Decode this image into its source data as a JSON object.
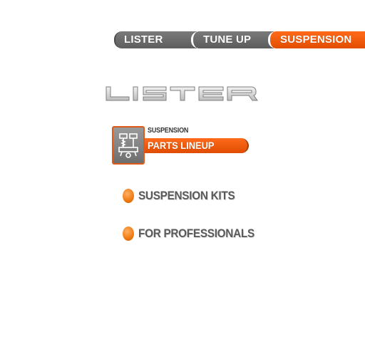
{
  "tabs": [
    {
      "label": "LISTER",
      "active": false
    },
    {
      "label": "TUNE UP",
      "active": false
    },
    {
      "label": "SUSPENSION",
      "active": true
    }
  ],
  "logo": {
    "text": "LISTER"
  },
  "section": {
    "small_label": "SUSPENSION",
    "title": "PARTS LINEUP",
    "icon": "suspension-part-icon"
  },
  "menu": {
    "items": [
      {
        "label": "SUSPENSION KITS"
      },
      {
        "label": "FOR PROFESSIONALS"
      }
    ]
  },
  "colors": {
    "accent": "#f05a0a",
    "tab_gray": "#6b6b6b",
    "bullet": "#ef7a10",
    "text_gray": "#5a5a5a"
  }
}
